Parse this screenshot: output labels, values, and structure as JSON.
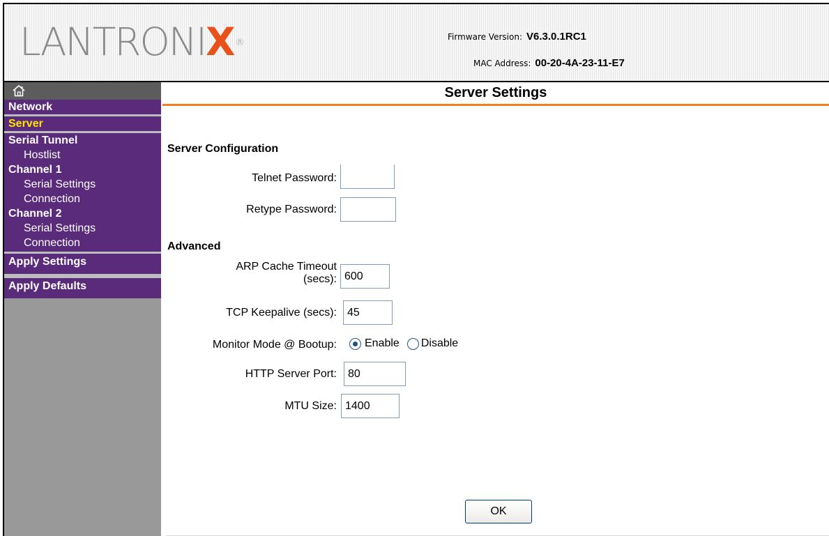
{
  "header": {
    "logo_main": "LANTRONI",
    "logo_x": "X",
    "logo_reg": "®",
    "firmware_label": "Firmware Version:",
    "firmware_value": "V6.3.0.1RC1",
    "mac_label": "MAC Address:",
    "mac_value": "00-20-4A-23-11-E7",
    "logo_colors": {
      "text": "#8a8a8a",
      "accent": "#e8511a"
    }
  },
  "sidebar": {
    "home_icon": "home-icon",
    "network": "Network",
    "server": "Server",
    "serial_tunnel": "Serial Tunnel",
    "hostlist": "Hostlist",
    "channel1": "Channel 1",
    "channel1_serial": "Serial Settings",
    "channel1_connection": "Connection",
    "channel2": "Channel 2",
    "channel2_serial": "Serial Settings",
    "channel2_connection": "Connection",
    "apply_settings": "Apply Settings",
    "apply_defaults": "Apply Defaults",
    "active_item": "Server",
    "colors": {
      "nav_bg": "#5a2b7a",
      "active_text": "#ffe200",
      "sidebar_bg": "#999999"
    }
  },
  "main": {
    "title": "Server Settings",
    "accent_color": "#f07f21",
    "server_config": {
      "heading": "Server Configuration",
      "telnet_label": "Telnet Password:",
      "telnet_value": "",
      "retype_label": "Retype Password:",
      "retype_value": ""
    },
    "advanced": {
      "heading": "Advanced",
      "arp_label_line1": "ARP Cache Timeout",
      "arp_label_line2": "(secs):",
      "arp_value": "600",
      "tcp_label": "TCP Keepalive (secs):",
      "tcp_value": "45",
      "monitor_label": "Monitor Mode @ Bootup:",
      "monitor_enable": "Enable",
      "monitor_disable": "Disable",
      "monitor_selected": "Enable",
      "http_label": "HTTP Server Port:",
      "http_value": "80",
      "mtu_label": "MTU Size:",
      "mtu_value": "1400"
    },
    "ok_button": "OK"
  }
}
